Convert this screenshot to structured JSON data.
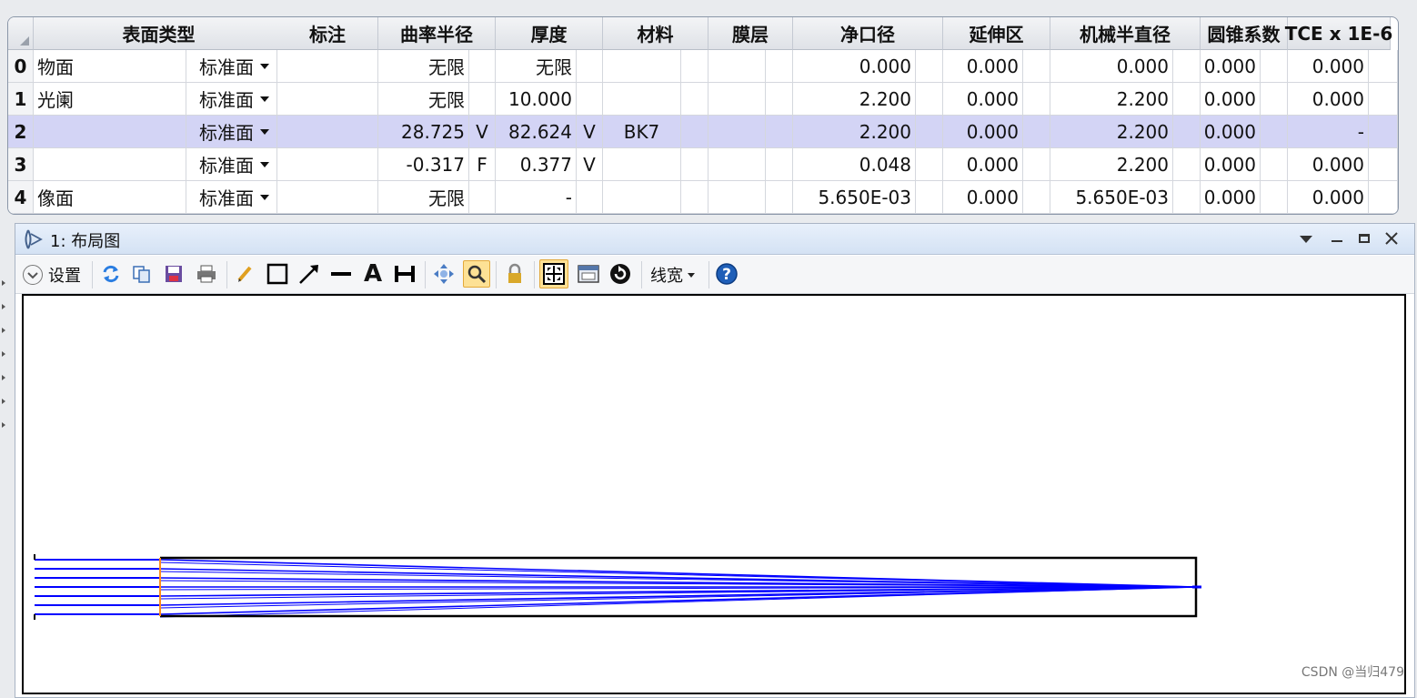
{
  "lens_data_editor": {
    "headers": [
      "表面类型",
      "标注",
      "曲率半径",
      "厚度",
      "材料",
      "膜层",
      "净口径",
      "延伸区",
      "机械半直径",
      "圆锥系数",
      "TCE x 1E-6"
    ],
    "rows": [
      {
        "num": "0",
        "comment": "物面",
        "type": "标准面",
        "radius": "无限",
        "radius_solve": "",
        "thickness": "无限",
        "thickness_solve": "",
        "material": "",
        "coating": "",
        "clear_semi": "0.000",
        "chip": "0.000",
        "mech": "0.000",
        "conic": "0.000",
        "tce": "0.000"
      },
      {
        "num": "1",
        "comment": "光阑",
        "type": "标准面",
        "radius": "无限",
        "radius_solve": "",
        "thickness": "10.000",
        "thickness_solve": "",
        "material": "",
        "coating": "",
        "clear_semi": "2.200",
        "chip": "0.000",
        "mech": "2.200",
        "conic": "0.000",
        "tce": "0.000"
      },
      {
        "num": "2",
        "comment": "",
        "type": "标准面",
        "radius": "28.725",
        "radius_solve": "V",
        "thickness": "82.624",
        "thickness_solve": "V",
        "material": "BK7",
        "coating": "",
        "clear_semi": "2.200",
        "chip": "0.000",
        "mech": "2.200",
        "conic": "0.000",
        "tce": "-"
      },
      {
        "num": "3",
        "comment": "",
        "type": "标准面",
        "radius": "-0.317",
        "radius_solve": "F",
        "thickness": "0.377",
        "thickness_solve": "V",
        "material": "",
        "coating": "",
        "clear_semi": "0.048",
        "chip": "0.000",
        "mech": "2.200",
        "conic": "0.000",
        "tce": "0.000"
      },
      {
        "num": "4",
        "comment": "像面",
        "type": "标准面",
        "radius": "无限",
        "radius_solve": "",
        "thickness": "-",
        "thickness_solve": "",
        "material": "",
        "coating": "",
        "clear_semi": "5.650E-03",
        "chip": "0.000",
        "mech": "5.650E-03",
        "conic": "0.000",
        "tce": "0.000"
      }
    ],
    "selected_row": 2,
    "colors": {
      "selected_row": "#d3d4f5",
      "header": "#e6e8ec"
    }
  },
  "layout_window": {
    "title": "1: 布局图",
    "title_icon": "lens-icon",
    "window_controls": [
      "dropdown-icon",
      "minimize-icon",
      "maximize-icon",
      "close-icon"
    ],
    "toolbar": {
      "settings_label": "设置",
      "line_width_label": "线宽",
      "icons": [
        "refresh-icon",
        "copy-icon",
        "save-icon",
        "print-icon",
        "pencil-icon",
        "rectangle-icon",
        "arrow-icon",
        "line-icon",
        "text-icon",
        "dimension-icon",
        "pan-icon",
        "zoom-icon",
        "lock-icon",
        "fit-icon",
        "window-icon",
        "rotate-icon",
        "help-icon"
      ]
    },
    "colors": {
      "rays": "#0000ff",
      "stop": "#ff8c1a",
      "lens": "#000000"
    }
  },
  "watermark": "CSDN @当归479"
}
